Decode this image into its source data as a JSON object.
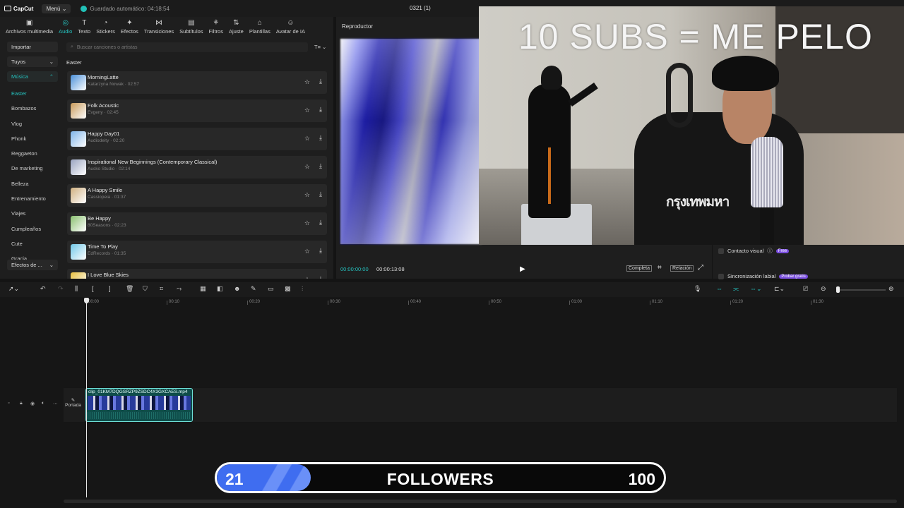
{
  "app": {
    "logo": "CapCut",
    "menu_label": "Menú",
    "autosave": "Guardado automático: 04:18:54",
    "project_title": "0321 (1)"
  },
  "tool_tabs": [
    {
      "label": "Archivos multimedia",
      "icon": "media-icon",
      "glyph": "▣"
    },
    {
      "label": "Audio",
      "icon": "audio-icon",
      "glyph": "◎",
      "active": true
    },
    {
      "label": "Texto",
      "icon": "text-icon",
      "glyph": "T"
    },
    {
      "label": "Stickers",
      "icon": "sticker-icon",
      "glyph": "◔"
    },
    {
      "label": "Efectos",
      "icon": "effects-icon",
      "glyph": "✦"
    },
    {
      "label": "Transiciones",
      "icon": "transition-icon",
      "glyph": "⋈"
    },
    {
      "label": "Subtítulos",
      "icon": "subtitle-icon",
      "glyph": "▤"
    },
    {
      "label": "Filtros",
      "icon": "filter-icon",
      "glyph": "⚘"
    },
    {
      "label": "Ajuste",
      "icon": "adjust-icon",
      "glyph": "⇅"
    },
    {
      "label": "Plantillas",
      "icon": "template-icon",
      "glyph": "⌂"
    },
    {
      "label": "Avatar de IA",
      "icon": "avatar-icon",
      "glyph": "☺"
    }
  ],
  "sidebar": {
    "import": "Importar",
    "yours": "Tuyos",
    "music": "Música",
    "categories": [
      "Easter",
      "Bombazos",
      "Vlog",
      "Phonk",
      "Reggaeton",
      "De marketing",
      "Belleza",
      "Entrenamiento",
      "Viajes",
      "Cumpleaños",
      "Cute",
      "Gracia"
    ],
    "sound_effects": "Efectos de ..."
  },
  "music_panel": {
    "search_placeholder": "Buscar canciones o artistas",
    "category_title": "Easter",
    "tracks": [
      {
        "title": "MorningLatte",
        "meta": "Katarzyna Nowak · 02:57",
        "color": "#4a8fd8"
      },
      {
        "title": "Folk Acoustic",
        "meta": "Evgeny · 02:45",
        "color": "#c89a5a"
      },
      {
        "title": "Happy Day01",
        "meta": "Audiodeity · 02:20",
        "color": "#7fb4e8"
      },
      {
        "title": "Inspirational New Beginnings (Contemporary Classical)",
        "meta": "Ausko Studio · 02:14",
        "color": "#9aa4c0"
      },
      {
        "title": "A Happy Smile",
        "meta": "Cassiopeia · 01:37",
        "color": "#d0b080"
      },
      {
        "title": "Be Happy",
        "meta": "80Seasons · 02:23",
        "color": "#8ac070"
      },
      {
        "title": "Time To Play",
        "meta": "EdRecords · 01:35",
        "color": "#70c8e8"
      },
      {
        "title": "I Love Blue Skies",
        "meta": "",
        "color": "#e8c040"
      }
    ]
  },
  "player": {
    "title": "Reproductor",
    "current_time": "00:00:00:00",
    "duration": "00:00:13:08",
    "full_label": "Completa",
    "ratio_label": "Relación"
  },
  "right_panel": {
    "visual_contact": "Contacto visual",
    "visual_badge": "Free",
    "lip_sync": "Sincronización labial",
    "lip_badge": "Probar gratis"
  },
  "overlay": {
    "webcam_text": "10 SUBS = ME PELO",
    "shirt_text": "กรุงเทพมหา"
  },
  "timeline": {
    "ruler": [
      "00:00",
      "00:10",
      "00:20",
      "00:30",
      "00:40",
      "00:50",
      "01:00",
      "01:10",
      "01:20",
      "01:30"
    ],
    "clip_name": "clip_01KM7DQGSRZP9ZSDC4X3GXCAES.mp4",
    "cover_label": "Portada"
  },
  "followers_bar": {
    "current": "21",
    "label": "FOLLOWERS",
    "goal": "100",
    "progress": 0.21
  }
}
